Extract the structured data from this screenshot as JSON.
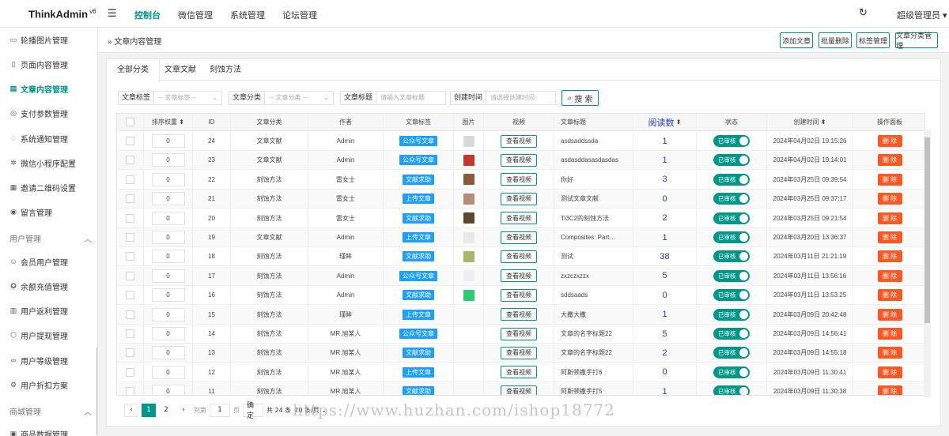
{
  "topbar": {
    "logo": "ThinkAdmin",
    "version": "v6",
    "nav": [
      "控制台",
      "微信管理",
      "系统管理",
      "论坛管理"
    ],
    "user": "超级管理员"
  },
  "sidebar": {
    "items": [
      {
        "label": "轮播图片管理",
        "icon": "image-icon",
        "glyph": "▭"
      },
      {
        "label": "页面内容管理",
        "icon": "book-icon",
        "glyph": "▯"
      },
      {
        "label": "文章内容管理",
        "icon": "article-icon",
        "glyph": "▤"
      },
      {
        "label": "支付参数管理",
        "icon": "coin-icon",
        "glyph": "◎"
      },
      {
        "label": "系统通知管理",
        "icon": "bell-icon",
        "glyph": "♢"
      },
      {
        "label": "微信小程序配置",
        "icon": "miniapp-icon",
        "glyph": "✲"
      },
      {
        "label": "邀请二维码设置",
        "icon": "qrcode-icon",
        "glyph": "▦"
      },
      {
        "label": "留言管理",
        "icon": "message-icon",
        "glyph": "◉"
      }
    ],
    "group1": "用户管理",
    "items2": [
      {
        "label": "会员用户管理",
        "icon": "user-icon",
        "glyph": "☺"
      },
      {
        "label": "余额充值管理",
        "icon": "wallet-icon",
        "glyph": "✪"
      },
      {
        "label": "用户返利管理",
        "icon": "rebate-icon",
        "glyph": "▥"
      },
      {
        "label": "用户提现管理",
        "icon": "withdraw-icon",
        "glyph": "⬡"
      },
      {
        "label": "用户等级管理",
        "icon": "level-icon",
        "glyph": "∞"
      },
      {
        "label": "用户折扣方案",
        "icon": "discount-icon",
        "glyph": "⚙"
      }
    ],
    "group2": "商城管理",
    "item_last": {
      "label": "商品数据管理",
      "icon": "goods-icon",
      "glyph": "▣"
    }
  },
  "header": {
    "breadcrumb": "文章内容管理",
    "buttons": [
      "添加文章",
      "批量删除",
      "标签管理",
      "文章分类管理"
    ]
  },
  "tabs": [
    "全部分类",
    "文章文献",
    "刻蚀方法"
  ],
  "filters": [
    {
      "label": "文章标签",
      "placeholder": "-- 文章标签 --"
    },
    {
      "label": "文章分类",
      "placeholder": "-- 文章分类 --"
    },
    {
      "label": "文章标题",
      "placeholder": "请输入文章标题"
    },
    {
      "label": "创建时间",
      "placeholder": "请选择创建时间"
    }
  ],
  "search_label": "搜 索",
  "columns": [
    "排序权重",
    "ID",
    "文章分类",
    "作者",
    "文章标签",
    "图片",
    "视频",
    "文章标题",
    "阅读数",
    "状态",
    "创建时间",
    "操作面板"
  ],
  "colors": {
    "accent": "#009688",
    "tag": "#1e9fff",
    "delete": "#ff5722"
  },
  "rows": [
    {
      "sort": "0",
      "id": "24",
      "cat": "文章文献",
      "author": "Admin",
      "tag": "公众号文章",
      "img": "#d9d9d9",
      "view": "查看视频",
      "title": "asdsaddssda",
      "reads": "1",
      "status": "已审核",
      "time": "2024年04月02日 19:15:26",
      "op": "删 除"
    },
    {
      "sort": "0",
      "id": "23",
      "cat": "文章文献",
      "author": "Admin",
      "tag": "公众号文章",
      "img": "#c0392b",
      "view": "查看视频",
      "title": "asdasddasasdasdas",
      "reads": "1",
      "status": "已审核",
      "time": "2024年04月02日 19:14:01",
      "op": "删 除"
    },
    {
      "sort": "0",
      "id": "22",
      "cat": "刻蚀方法",
      "author": "雷女士",
      "tag": "文献求助",
      "img": "#8e5a3c",
      "view": "查看视频",
      "title": "你好",
      "reads": "3",
      "status": "已审核",
      "time": "2024年03月25日 09:39:54",
      "op": "删 除"
    },
    {
      "sort": "0",
      "id": "21",
      "cat": "刻蚀方法",
      "author": "雷女士",
      "tag": "上传文章",
      "img": "#b58b7a",
      "view": "查看视频",
      "title": "测试文章文献",
      "reads": "0",
      "status": "已审核",
      "time": "2024年03月25日 09:37:17",
      "op": "删 除"
    },
    {
      "sort": "0",
      "id": "20",
      "cat": "刻蚀方法",
      "author": "雷女士",
      "tag": "文献求助",
      "img": "#5a4a2a",
      "view": "查看视频",
      "title": "Ti3C2的刻蚀方法",
      "reads": "2",
      "status": "已审核",
      "time": "2024年03月25日 09:21:54",
      "op": "删 除"
    },
    {
      "sort": "0",
      "id": "19",
      "cat": "文章文献",
      "author": "Admin",
      "tag": "上传文章",
      "img": "#e8e8e8",
      "view": "查看视频",
      "title": "Composites: Part…",
      "reads": "1",
      "status": "已审核",
      "time": "2024年03月20日 13:36:37",
      "op": "删 除"
    },
    {
      "sort": "0",
      "id": "18",
      "cat": "刻蚀方法",
      "author": "瑾眸",
      "tag": "文献求助",
      "img": "#a3b86c",
      "view": "查看视频",
      "title": "测试",
      "reads": "38",
      "status": "已审核",
      "time": "2024年03月11日 21:21:19",
      "op": "删 除"
    },
    {
      "sort": "0",
      "id": "17",
      "cat": "刻蚀方法",
      "author": "Admin",
      "tag": "公众号文章",
      "img": "#eeeeee",
      "view": "查看视频",
      "title": "zxzczxzzx",
      "reads": "5",
      "status": "已审核",
      "time": "2024年03月11日 13:56:16",
      "op": "删 除"
    },
    {
      "sort": "0",
      "id": "16",
      "cat": "刻蚀方法",
      "author": "Admin",
      "tag": "文献求助",
      "img": "#2ecc71",
      "view": "查看视频",
      "title": "sddsaads",
      "reads": "0",
      "status": "已审核",
      "time": "2024年03月11日 13:53:25",
      "op": "删 除"
    },
    {
      "sort": "0",
      "id": "15",
      "cat": "刻蚀方法",
      "author": "瑾眸",
      "tag": "上传文章",
      "img": "",
      "view": "查看视频",
      "title": "大撒大撒",
      "reads": "1",
      "status": "已审核",
      "time": "2024年03月09日 20:42:48",
      "op": "删 除"
    },
    {
      "sort": "0",
      "id": "14",
      "cat": "刻蚀方法",
      "author": "MR.旭某人",
      "tag": "公众号文章",
      "img": "",
      "view": "查看视频",
      "title": "文章的名字标题22",
      "reads": "5",
      "status": "已审核",
      "time": "2024年03月09日 14:56:41",
      "op": "删 除"
    },
    {
      "sort": "0",
      "id": "13",
      "cat": "刻蚀方法",
      "author": "MR.旭某人",
      "tag": "文献求助",
      "img": "",
      "view": "查看视频",
      "title": "文章的名字标题22",
      "reads": "2",
      "status": "已审核",
      "time": "2024年03月09日 14:55:18",
      "op": "删 除"
    },
    {
      "sort": "0",
      "id": "12",
      "cat": "刻蚀方法",
      "author": "MR.旭某人",
      "tag": "上传文章",
      "img": "",
      "view": "查看视频",
      "title": "阿斯顿撒手打6",
      "reads": "0",
      "status": "已审核",
      "time": "2024年03月09日 11:30:41",
      "op": "删 除"
    },
    {
      "sort": "0",
      "id": "11",
      "cat": "刻蚀方法",
      "author": "MR.旭某人",
      "tag": "文献求助",
      "img": "",
      "view": "查看视频",
      "title": "阿斯顿撒手打5",
      "reads": "1",
      "status": "已审核",
      "time": "2024年03月09日 11:30:38",
      "op": "删 除"
    }
  ],
  "pager": {
    "prev": "‹",
    "pages": [
      "1",
      "2"
    ],
    "next": "›",
    "goto": "到第",
    "input": "1",
    "page_unit": "页",
    "confirm": "确定",
    "total": "共 24 条",
    "per_page": "20 条/页"
  },
  "watermark": "https://www.huzhan.com/ishop18772"
}
